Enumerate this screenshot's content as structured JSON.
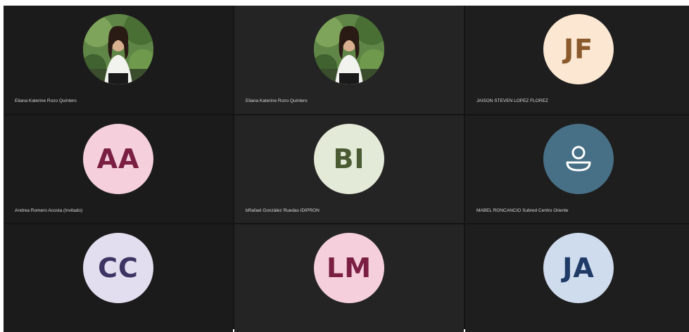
{
  "participants": [
    {
      "name": "Eliana Katerine Rozo Quintero",
      "initials": "",
      "avatar_type": "photo",
      "bg": "#6b8e4e",
      "fg": ""
    },
    {
      "name": "Eliana Katerine Rozo Quintero",
      "initials": "",
      "avatar_type": "photo",
      "bg": "#6b8e4e",
      "fg": ""
    },
    {
      "name": "JAISON STEVEN LOPEZ FLOREZ",
      "initials": "JF",
      "avatar_type": "initials",
      "bg": "#fbe7d2",
      "fg": "#8a5a2c"
    },
    {
      "name": "Andrea Romero Acosta (Invitado)",
      "initials": "AA",
      "avatar_type": "initials",
      "bg": "#f5cfdc",
      "fg": "#7a1f42"
    },
    {
      "name": "bRafael González Ruedas IDIPRON",
      "initials": "BI",
      "avatar_type": "initials",
      "bg": "#e3ead8",
      "fg": "#4a5a33"
    },
    {
      "name": "MABEL RONCANCIO Subred Centro Oriente",
      "initials": "",
      "avatar_type": "generic-user-icon",
      "bg": "#477086",
      "fg": "#ffffff"
    },
    {
      "name": "",
      "initials": "CC",
      "avatar_type": "initials",
      "bg": "#e2deef",
      "fg": "#3d3463"
    },
    {
      "name": "",
      "initials": "LM",
      "avatar_type": "initials",
      "bg": "#f5cfdc",
      "fg": "#7a1f42"
    },
    {
      "name": "",
      "initials": "JA",
      "avatar_type": "initials",
      "bg": "#cfdcee",
      "fg": "#1f3a66"
    }
  ]
}
